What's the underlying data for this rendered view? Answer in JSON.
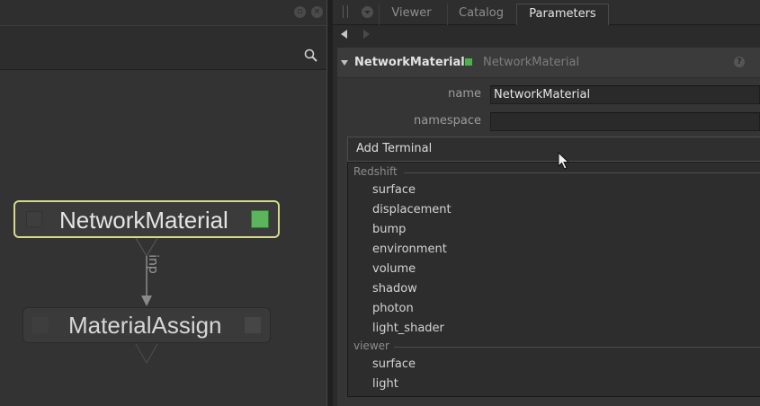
{
  "graph": {
    "nodes": [
      {
        "name": "NetworkMaterial"
      },
      {
        "name": "MaterialAssign"
      }
    ],
    "connection_label": "inp"
  },
  "right_pane": {
    "tabs": [
      {
        "label": "Viewer",
        "active": false
      },
      {
        "label": "Catalog",
        "active": false
      },
      {
        "label": "Parameters",
        "active": true
      }
    ],
    "panel": {
      "node_name": "NetworkMaterial",
      "node_type": "NetworkMaterial",
      "fields": [
        {
          "label": "name",
          "value": "NetworkMaterial"
        },
        {
          "label": "namespace",
          "value": ""
        }
      ],
      "add_terminal_label": "Add Terminal",
      "menu": {
        "sections": [
          {
            "title": "Redshift",
            "items": [
              "surface",
              "displacement",
              "bump",
              "environment",
              "volume",
              "shadow",
              "photon",
              "light_shader"
            ]
          },
          {
            "title": "viewer",
            "items": [
              "surface",
              "light"
            ]
          }
        ]
      }
    }
  },
  "colors": {
    "selected_node_border": "#d4d98c",
    "status_green": "#5cb45c"
  }
}
